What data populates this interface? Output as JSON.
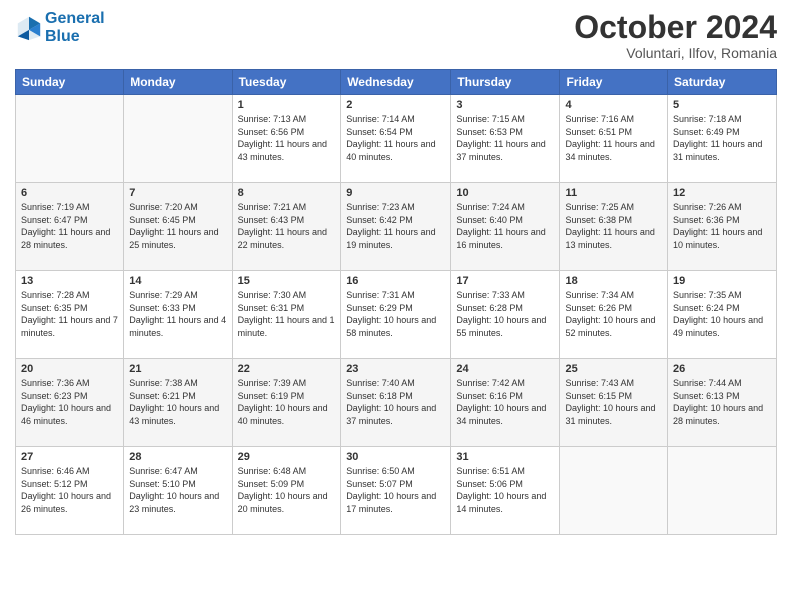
{
  "header": {
    "logo_line1": "General",
    "logo_line2": "Blue",
    "month": "October 2024",
    "location": "Voluntari, Ilfov, Romania"
  },
  "weekdays": [
    "Sunday",
    "Monday",
    "Tuesday",
    "Wednesday",
    "Thursday",
    "Friday",
    "Saturday"
  ],
  "weeks": [
    [
      {
        "day": "",
        "info": ""
      },
      {
        "day": "",
        "info": ""
      },
      {
        "day": "1",
        "info": "Sunrise: 7:13 AM\nSunset: 6:56 PM\nDaylight: 11 hours and 43 minutes."
      },
      {
        "day": "2",
        "info": "Sunrise: 7:14 AM\nSunset: 6:54 PM\nDaylight: 11 hours and 40 minutes."
      },
      {
        "day": "3",
        "info": "Sunrise: 7:15 AM\nSunset: 6:53 PM\nDaylight: 11 hours and 37 minutes."
      },
      {
        "day": "4",
        "info": "Sunrise: 7:16 AM\nSunset: 6:51 PM\nDaylight: 11 hours and 34 minutes."
      },
      {
        "day": "5",
        "info": "Sunrise: 7:18 AM\nSunset: 6:49 PM\nDaylight: 11 hours and 31 minutes."
      }
    ],
    [
      {
        "day": "6",
        "info": "Sunrise: 7:19 AM\nSunset: 6:47 PM\nDaylight: 11 hours and 28 minutes."
      },
      {
        "day": "7",
        "info": "Sunrise: 7:20 AM\nSunset: 6:45 PM\nDaylight: 11 hours and 25 minutes."
      },
      {
        "day": "8",
        "info": "Sunrise: 7:21 AM\nSunset: 6:43 PM\nDaylight: 11 hours and 22 minutes."
      },
      {
        "day": "9",
        "info": "Sunrise: 7:23 AM\nSunset: 6:42 PM\nDaylight: 11 hours and 19 minutes."
      },
      {
        "day": "10",
        "info": "Sunrise: 7:24 AM\nSunset: 6:40 PM\nDaylight: 11 hours and 16 minutes."
      },
      {
        "day": "11",
        "info": "Sunrise: 7:25 AM\nSunset: 6:38 PM\nDaylight: 11 hours and 13 minutes."
      },
      {
        "day": "12",
        "info": "Sunrise: 7:26 AM\nSunset: 6:36 PM\nDaylight: 11 hours and 10 minutes."
      }
    ],
    [
      {
        "day": "13",
        "info": "Sunrise: 7:28 AM\nSunset: 6:35 PM\nDaylight: 11 hours and 7 minutes."
      },
      {
        "day": "14",
        "info": "Sunrise: 7:29 AM\nSunset: 6:33 PM\nDaylight: 11 hours and 4 minutes."
      },
      {
        "day": "15",
        "info": "Sunrise: 7:30 AM\nSunset: 6:31 PM\nDaylight: 11 hours and 1 minute."
      },
      {
        "day": "16",
        "info": "Sunrise: 7:31 AM\nSunset: 6:29 PM\nDaylight: 10 hours and 58 minutes."
      },
      {
        "day": "17",
        "info": "Sunrise: 7:33 AM\nSunset: 6:28 PM\nDaylight: 10 hours and 55 minutes."
      },
      {
        "day": "18",
        "info": "Sunrise: 7:34 AM\nSunset: 6:26 PM\nDaylight: 10 hours and 52 minutes."
      },
      {
        "day": "19",
        "info": "Sunrise: 7:35 AM\nSunset: 6:24 PM\nDaylight: 10 hours and 49 minutes."
      }
    ],
    [
      {
        "day": "20",
        "info": "Sunrise: 7:36 AM\nSunset: 6:23 PM\nDaylight: 10 hours and 46 minutes."
      },
      {
        "day": "21",
        "info": "Sunrise: 7:38 AM\nSunset: 6:21 PM\nDaylight: 10 hours and 43 minutes."
      },
      {
        "day": "22",
        "info": "Sunrise: 7:39 AM\nSunset: 6:19 PM\nDaylight: 10 hours and 40 minutes."
      },
      {
        "day": "23",
        "info": "Sunrise: 7:40 AM\nSunset: 6:18 PM\nDaylight: 10 hours and 37 minutes."
      },
      {
        "day": "24",
        "info": "Sunrise: 7:42 AM\nSunset: 6:16 PM\nDaylight: 10 hours and 34 minutes."
      },
      {
        "day": "25",
        "info": "Sunrise: 7:43 AM\nSunset: 6:15 PM\nDaylight: 10 hours and 31 minutes."
      },
      {
        "day": "26",
        "info": "Sunrise: 7:44 AM\nSunset: 6:13 PM\nDaylight: 10 hours and 28 minutes."
      }
    ],
    [
      {
        "day": "27",
        "info": "Sunrise: 6:46 AM\nSunset: 5:12 PM\nDaylight: 10 hours and 26 minutes."
      },
      {
        "day": "28",
        "info": "Sunrise: 6:47 AM\nSunset: 5:10 PM\nDaylight: 10 hours and 23 minutes."
      },
      {
        "day": "29",
        "info": "Sunrise: 6:48 AM\nSunset: 5:09 PM\nDaylight: 10 hours and 20 minutes."
      },
      {
        "day": "30",
        "info": "Sunrise: 6:50 AM\nSunset: 5:07 PM\nDaylight: 10 hours and 17 minutes."
      },
      {
        "day": "31",
        "info": "Sunrise: 6:51 AM\nSunset: 5:06 PM\nDaylight: 10 hours and 14 minutes."
      },
      {
        "day": "",
        "info": ""
      },
      {
        "day": "",
        "info": ""
      }
    ]
  ]
}
